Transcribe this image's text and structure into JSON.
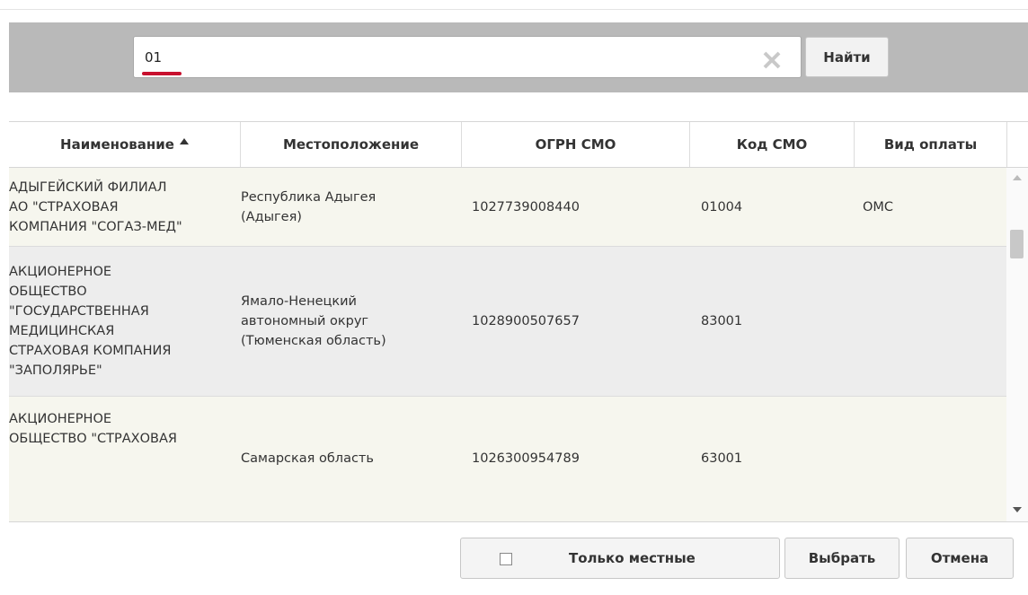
{
  "search": {
    "value": "01",
    "find_label": "Найти"
  },
  "table": {
    "columns": [
      "Наименование",
      "Местоположение",
      "ОГРН СМО",
      "Код СМО",
      "Вид оплаты"
    ],
    "sort_column": "Наименование",
    "sort_direction": "ascending",
    "rows": [
      {
        "name_lines": [
          "АДЫГЕЙСКИЙ ФИЛИАЛ",
          "АО \"СТРАХОВАЯ",
          "КОМПАНИЯ \"СОГАЗ-МЕД\""
        ],
        "location_lines": [
          "Республика Адыгея",
          "(Адыгея)"
        ],
        "ogrn": "1027739008440",
        "code": "01004",
        "payment": "ОМС"
      },
      {
        "name_lines": [
          "АКЦИОНЕРНОЕ",
          "ОБЩЕСТВО",
          "\"ГОСУДАРСТВЕННАЯ",
          "МЕДИЦИНСКАЯ",
          "СТРАХОВАЯ КОМПАНИЯ",
          "\"ЗАПОЛЯРЬЕ\""
        ],
        "location_lines": [
          "Ямало-Ненецкий",
          "автономный округ",
          "(Тюменская область)"
        ],
        "ogrn": "1028900507657",
        "code": "83001",
        "payment": ""
      },
      {
        "name_lines": [
          "АКЦИОНЕРНОЕ",
          "ОБЩЕСТВО \"СТРАХОВАЯ"
        ],
        "location_lines": [
          "Самарская область"
        ],
        "ogrn": "1026300954789",
        "code": "63001",
        "payment": ""
      }
    ]
  },
  "footer": {
    "local_only_label": "Только местные",
    "local_only_checked": false,
    "select_label": "Выбрать",
    "cancel_label": "Отмена"
  },
  "colors": {
    "search_bar_bg": "#b9b9b9",
    "row_highlight": "#f6f6ee",
    "row_alt": "#ededed",
    "accent_underline": "#c8102e"
  }
}
